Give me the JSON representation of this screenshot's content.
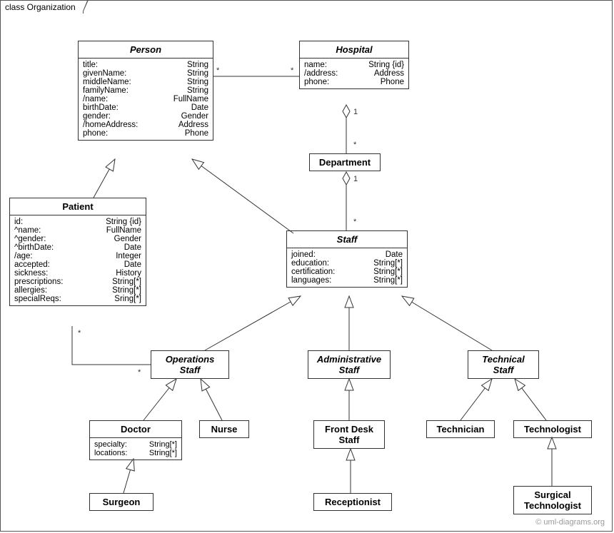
{
  "frame": {
    "tab": "class Organization"
  },
  "watermark": "© uml-diagrams.org",
  "classes": {
    "person": {
      "title": "Person",
      "attrs": [
        {
          "n": "title:",
          "t": "String"
        },
        {
          "n": "givenName:",
          "t": "String"
        },
        {
          "n": "middleName:",
          "t": "String"
        },
        {
          "n": "familyName:",
          "t": "String"
        },
        {
          "n": "/name:",
          "t": "FullName"
        },
        {
          "n": "birthDate:",
          "t": "Date"
        },
        {
          "n": "gender:",
          "t": "Gender"
        },
        {
          "n": "/homeAddress:",
          "t": "Address"
        },
        {
          "n": "phone:",
          "t": "Phone"
        }
      ]
    },
    "hospital": {
      "title": "Hospital",
      "attrs": [
        {
          "n": "name:",
          "t": "String {id}"
        },
        {
          "n": "/address:",
          "t": "Address"
        },
        {
          "n": "phone:",
          "t": "Phone"
        }
      ]
    },
    "department": {
      "title": "Department"
    },
    "patient": {
      "title": "Patient",
      "attrs": [
        {
          "n": "id:",
          "t": "String {id}"
        },
        {
          "n": "^name:",
          "t": "FullName"
        },
        {
          "n": "^gender:",
          "t": "Gender"
        },
        {
          "n": "^birthDate:",
          "t": "Date"
        },
        {
          "n": "/age:",
          "t": "Integer"
        },
        {
          "n": "accepted:",
          "t": "Date"
        },
        {
          "n": "sickness:",
          "t": "History"
        },
        {
          "n": "prescriptions:",
          "t": "String[*]"
        },
        {
          "n": "allergies:",
          "t": "String[*]"
        },
        {
          "n": "specialReqs:",
          "t": "Sring[*]"
        }
      ]
    },
    "staff": {
      "title": "Staff",
      "attrs": [
        {
          "n": "joined:",
          "t": "Date"
        },
        {
          "n": "education:",
          "t": "String[*]"
        },
        {
          "n": "certification:",
          "t": "String[*]"
        },
        {
          "n": "languages:",
          "t": "String[*]"
        }
      ]
    },
    "opstaff": {
      "title": "Operations\nStaff"
    },
    "adminstaff": {
      "title": "Administrative\nStaff"
    },
    "techstaff": {
      "title": "Technical\nStaff"
    },
    "doctor": {
      "title": "Doctor",
      "attrs": [
        {
          "n": "specialty:",
          "t": "String[*]"
        },
        {
          "n": "locations:",
          "t": "String[*]"
        }
      ]
    },
    "nurse": {
      "title": "Nurse"
    },
    "frontdesk": {
      "title": "Front Desk\nStaff"
    },
    "technician": {
      "title": "Technician"
    },
    "technologist": {
      "title": "Technologist"
    },
    "surgeon": {
      "title": "Surgeon"
    },
    "receptionist": {
      "title": "Receptionist"
    },
    "surgtech": {
      "title": "Surgical\nTechnologist"
    }
  },
  "mults": {
    "person_hosp_l": "*",
    "person_hosp_r": "*",
    "hosp_dept_top": "1",
    "hosp_dept_bot": "*",
    "dept_staff_top": "1",
    "dept_staff_bot": "*",
    "patient_ops_l": "*",
    "patient_ops_r": "*"
  }
}
